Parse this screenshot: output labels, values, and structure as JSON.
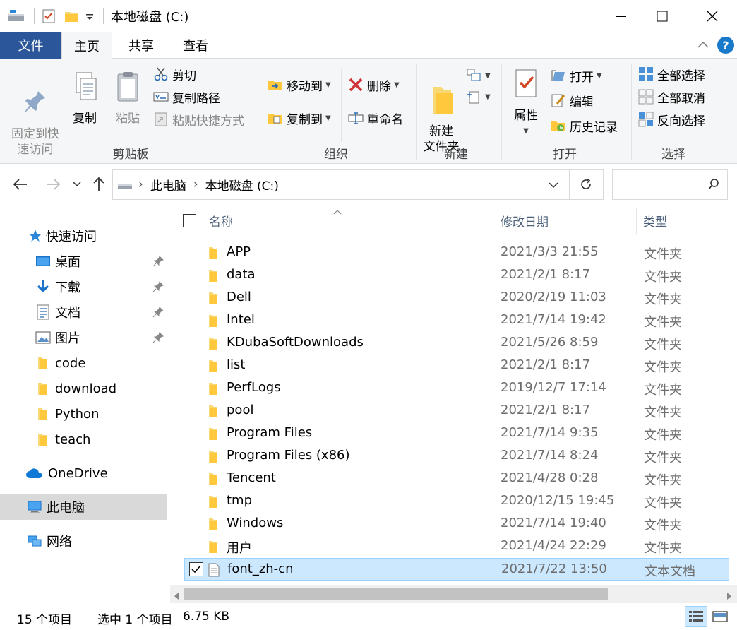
{
  "window": {
    "title": "本地磁盘 (C:)",
    "accent": "#2b579a"
  },
  "ribbon_tabs": [
    {
      "label": "文件"
    },
    {
      "label": "主页"
    },
    {
      "label": "共享"
    },
    {
      "label": "查看"
    }
  ],
  "ribbon": {
    "clipboard": {
      "label": "剪贴板",
      "pin_quick": "固定到快\n速访问",
      "copy": "复制",
      "paste": "粘贴",
      "cut": "剪切",
      "copy_path": "复制路径",
      "paste_shortcut": "粘贴快捷方式"
    },
    "organize": {
      "label": "组织",
      "move_to": "移动到",
      "copy_to": "复制到",
      "delete": "删除",
      "rename": "重命名"
    },
    "new": {
      "label": "新建",
      "new_folder": "新建\n文件夹"
    },
    "open": {
      "label": "打开",
      "properties": "属性",
      "open": "打开",
      "edit": "编辑",
      "history": "历史记录"
    },
    "select": {
      "label": "选择",
      "select_all": "全部选择",
      "select_none": "全部取消",
      "invert": "反向选择"
    }
  },
  "address": {
    "crumbs": [
      "此电脑",
      "本地磁盘 (C:)"
    ]
  },
  "nav": {
    "quick_access": "快速访问",
    "pinned": [
      {
        "label": "桌面",
        "icon": "desktop-icon"
      },
      {
        "label": "下载",
        "icon": "download-arrow-icon"
      },
      {
        "label": "文档",
        "icon": "documents-icon"
      },
      {
        "label": "图片",
        "icon": "pictures-icon"
      }
    ],
    "folders": [
      "code",
      "download",
      "Python",
      "teach"
    ],
    "onedrive": "OneDrive",
    "this_pc": "此电脑",
    "network": "网络"
  },
  "columns": {
    "name": "名称",
    "date": "修改日期",
    "type": "类型"
  },
  "files": [
    {
      "name": "APP",
      "date": "2021/3/3 21:55",
      "type": "文件夹",
      "kind": "folder"
    },
    {
      "name": "data",
      "date": "2021/2/1 8:17",
      "type": "文件夹",
      "kind": "folder"
    },
    {
      "name": "Dell",
      "date": "2020/2/19 11:03",
      "type": "文件夹",
      "kind": "folder"
    },
    {
      "name": "Intel",
      "date": "2021/7/14 19:42",
      "type": "文件夹",
      "kind": "folder"
    },
    {
      "name": "KDubaSoftDownloads",
      "date": "2021/5/26 8:59",
      "type": "文件夹",
      "kind": "folder"
    },
    {
      "name": "list",
      "date": "2021/2/1 8:17",
      "type": "文件夹",
      "kind": "folder"
    },
    {
      "name": "PerfLogs",
      "date": "2019/12/7 17:14",
      "type": "文件夹",
      "kind": "folder"
    },
    {
      "name": "pool",
      "date": "2021/2/1 8:17",
      "type": "文件夹",
      "kind": "folder"
    },
    {
      "name": "Program Files",
      "date": "2021/7/14 9:35",
      "type": "文件夹",
      "kind": "folder"
    },
    {
      "name": "Program Files (x86)",
      "date": "2021/7/14 8:24",
      "type": "文件夹",
      "kind": "folder"
    },
    {
      "name": "Tencent",
      "date": "2021/4/28 0:28",
      "type": "文件夹",
      "kind": "folder"
    },
    {
      "name": "tmp",
      "date": "2020/12/15 19:45",
      "type": "文件夹",
      "kind": "folder"
    },
    {
      "name": "Windows",
      "date": "2021/7/14 19:40",
      "type": "文件夹",
      "kind": "folder"
    },
    {
      "name": "用户",
      "date": "2021/4/24 22:29",
      "type": "文件夹",
      "kind": "folder"
    },
    {
      "name": "font_zh-cn",
      "date": "2021/7/22 13:50",
      "type": "文本文档",
      "kind": "text",
      "selected": true
    }
  ],
  "status": {
    "count": "15 个项目",
    "selection": "选中 1 个项目",
    "size": "6.75 KB"
  }
}
